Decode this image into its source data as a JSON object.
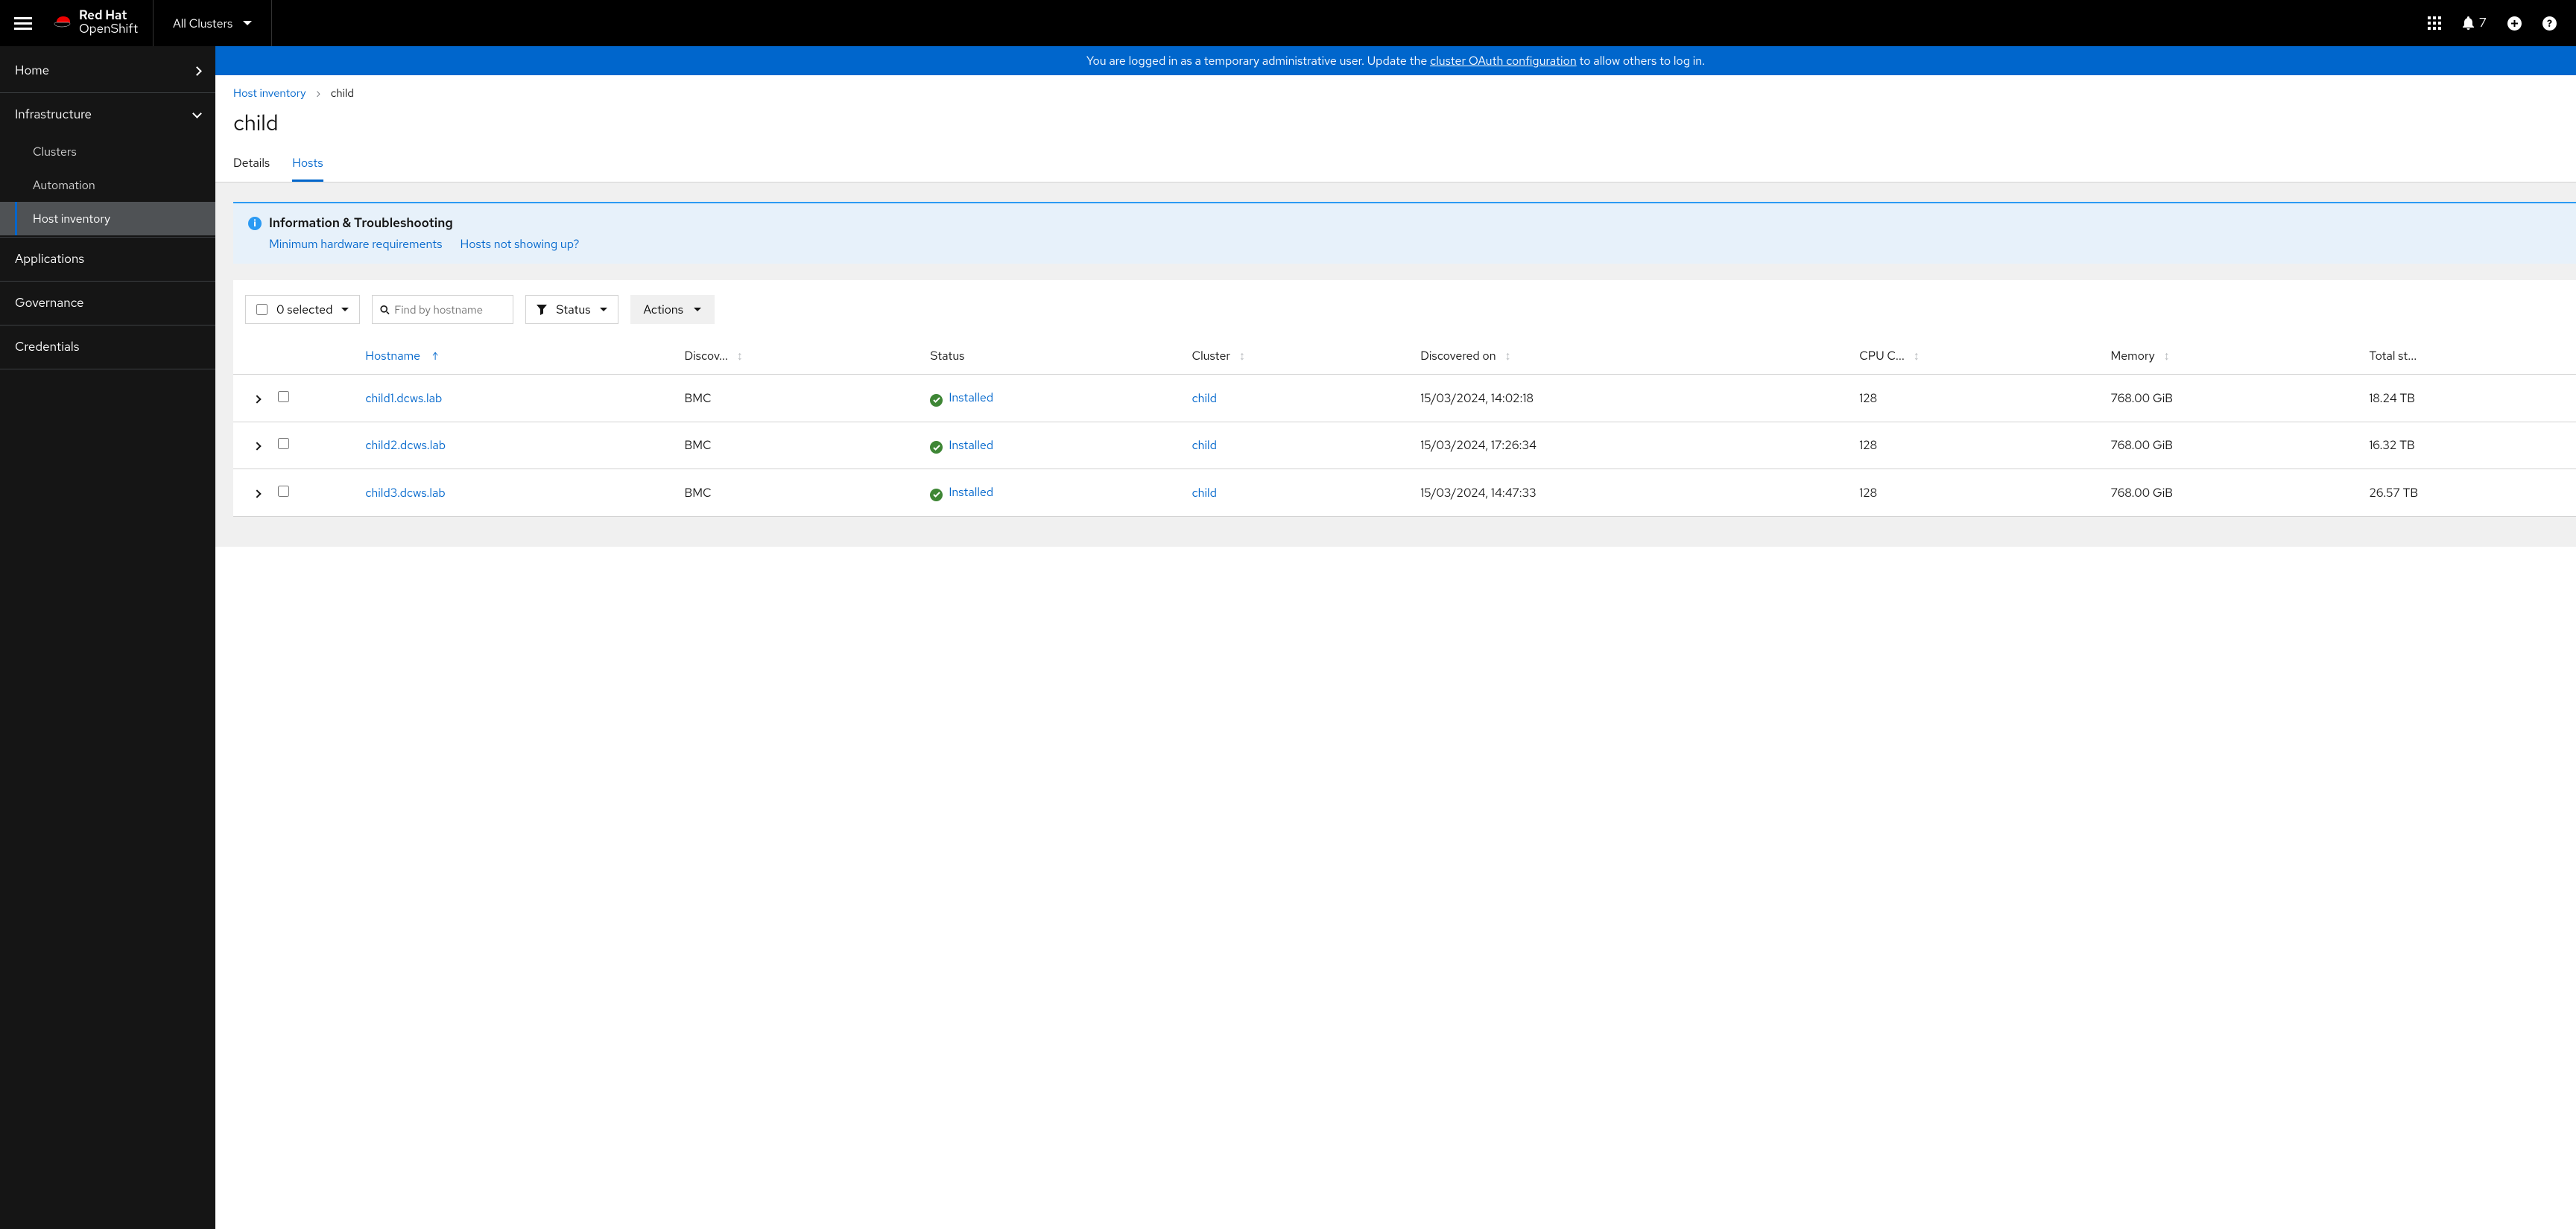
{
  "brand": {
    "line1": "Red Hat",
    "line2": "OpenShift"
  },
  "context_switcher": "All Clusters",
  "notifications": "7",
  "sidebar": {
    "home": "Home",
    "infrastructure": "Infrastructure",
    "clusters": "Clusters",
    "automation": "Automation",
    "host_inventory": "Host inventory",
    "applications": "Applications",
    "governance": "Governance",
    "credentials": "Credentials"
  },
  "banner": {
    "pre": "You are logged in as a temporary administrative user. Update the ",
    "link": "cluster OAuth configuration",
    "post": " to allow others to log in."
  },
  "breadcrumb": {
    "root": "Host inventory",
    "current": "child"
  },
  "page_title": "child",
  "tabs": {
    "details": "Details",
    "hosts": "Hosts"
  },
  "info": {
    "title": "Information & Troubleshooting",
    "link1": "Minimum hardware requirements",
    "link2": "Hosts not showing up?"
  },
  "toolbar": {
    "selected": "0 selected",
    "search_placeholder": "Find by hostname",
    "status": "Status",
    "actions": "Actions"
  },
  "columns": {
    "hostname": "Hostname",
    "discovery": "Discov...",
    "status": "Status",
    "cluster": "Cluster",
    "discovered_on": "Discovered on",
    "cpu": "CPU C...",
    "memory": "Memory",
    "storage": "Total st..."
  },
  "rows": [
    {
      "hostname": "child1.dcws.lab",
      "discovery": "BMC",
      "status": "Installed",
      "cluster": "child",
      "discovered": "15/03/2024, 14:02:18",
      "cpu": "128",
      "memory": "768.00 GiB",
      "storage": "18.24 TB"
    },
    {
      "hostname": "child2.dcws.lab",
      "discovery": "BMC",
      "status": "Installed",
      "cluster": "child",
      "discovered": "15/03/2024, 17:26:34",
      "cpu": "128",
      "memory": "768.00 GiB",
      "storage": "16.32 TB"
    },
    {
      "hostname": "child3.dcws.lab",
      "discovery": "BMC",
      "status": "Installed",
      "cluster": "child",
      "discovered": "15/03/2024, 14:47:33",
      "cpu": "128",
      "memory": "768.00 GiB",
      "storage": "26.57 TB"
    }
  ]
}
